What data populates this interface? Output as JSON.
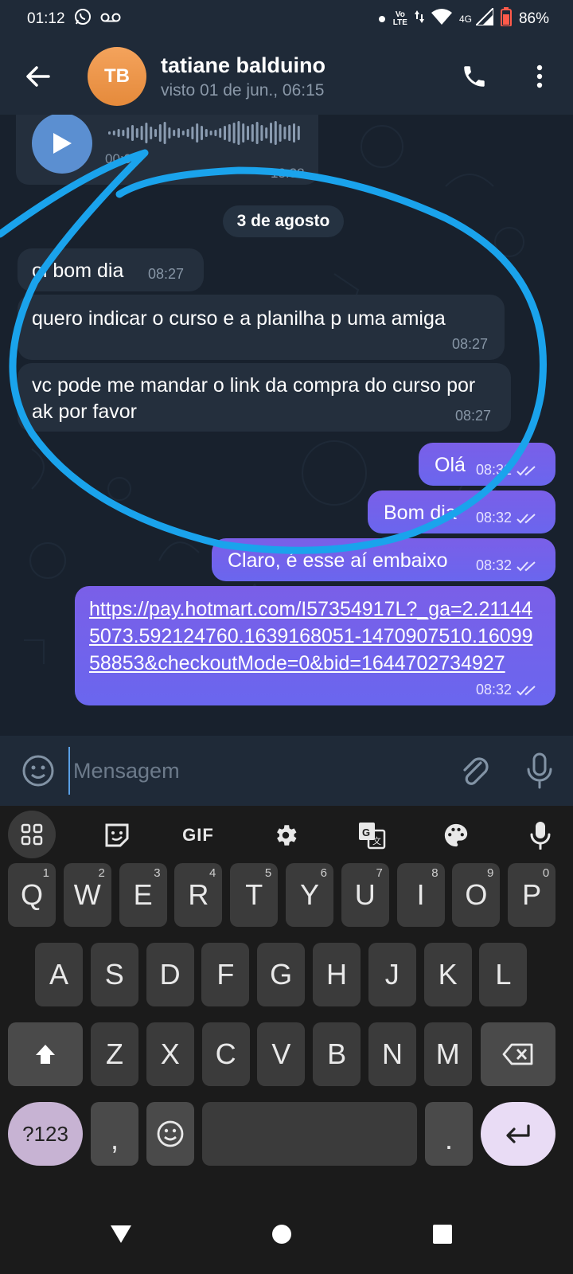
{
  "status_bar": {
    "time": "01:12",
    "volte_top": "Vo",
    "volte_bottom": "LTE",
    "network": "4G",
    "battery": "86%"
  },
  "header": {
    "avatar_initials": "TB",
    "contact_name": "tatiane balduino",
    "last_seen": "visto 01 de jun., 06:15"
  },
  "voice_message": {
    "duration": "00:06",
    "time": "13:38"
  },
  "date_separator": "3 de agosto",
  "messages_in": [
    {
      "text": "oi bom dia",
      "time": "08:27"
    },
    {
      "text": "quero indicar o curso e a planilha p uma amiga",
      "time": "08:27"
    },
    {
      "text": "vc pode me mandar o link da compra do curso por ak por favor",
      "time": "08:27"
    }
  ],
  "messages_out": [
    {
      "text": "Olá",
      "time": "08:32"
    },
    {
      "text": "Bom dia",
      "time": "08:32"
    },
    {
      "text": "Claro, é esse aí embaixo",
      "time": "08:32"
    },
    {
      "text": "https://pay.hotmart.com/I57354917L?_ga=2.211445073.592124760.1639168051-1470907510.1609958853&checkoutMode=0&bid=1644702734927",
      "time": "08:32"
    }
  ],
  "input": {
    "placeholder": "Mensagem"
  },
  "keyboard": {
    "toolbar_gif": "GIF",
    "row1": [
      {
        "key": "Q",
        "hint": "1"
      },
      {
        "key": "W",
        "hint": "2"
      },
      {
        "key": "E",
        "hint": "3"
      },
      {
        "key": "R",
        "hint": "4"
      },
      {
        "key": "T",
        "hint": "5"
      },
      {
        "key": "Y",
        "hint": "6"
      },
      {
        "key": "U",
        "hint": "7"
      },
      {
        "key": "I",
        "hint": "8"
      },
      {
        "key": "O",
        "hint": "9"
      },
      {
        "key": "P",
        "hint": "0"
      }
    ],
    "row2": [
      "A",
      "S",
      "D",
      "F",
      "G",
      "H",
      "J",
      "K",
      "L"
    ],
    "row3": [
      "Z",
      "X",
      "C",
      "V",
      "B",
      "N",
      "M"
    ],
    "sym_label": "?123",
    "comma": ",",
    "period": "."
  },
  "colors": {
    "header_bg": "#1f2a38",
    "incoming_bubble": "#242f3d",
    "outgoing_bubble": "#6c63ff",
    "scribble": "#1aa3ec",
    "avatar": "#ef9a4f"
  }
}
